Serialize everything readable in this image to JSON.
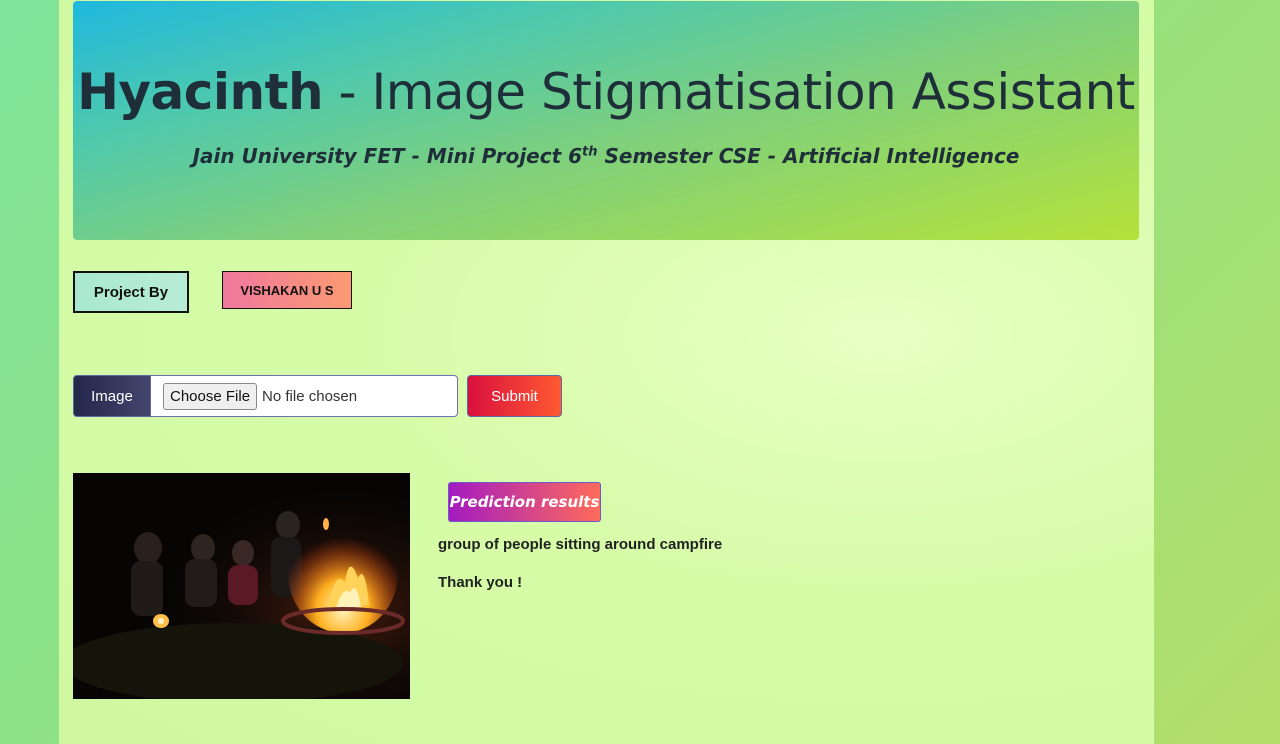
{
  "header": {
    "brand": "Hyacinth",
    "title_rest": " - Image Stigmatisation Assistant",
    "subtitle_pre": "Jain University FET - Mini Project 6",
    "subtitle_sup": "th",
    "subtitle_post": " Semester CSE - Artificial Intelligence"
  },
  "project": {
    "by_label": "Project By",
    "author": "VISHAKAN U S"
  },
  "form": {
    "image_label": "Image",
    "choose_file_label": "Choose File",
    "file_status": "No file chosen",
    "submit_label": "Submit"
  },
  "results": {
    "badge": "Prediction results",
    "prediction": "group of people sitting around campfire",
    "thanks": "Thank you !"
  }
}
